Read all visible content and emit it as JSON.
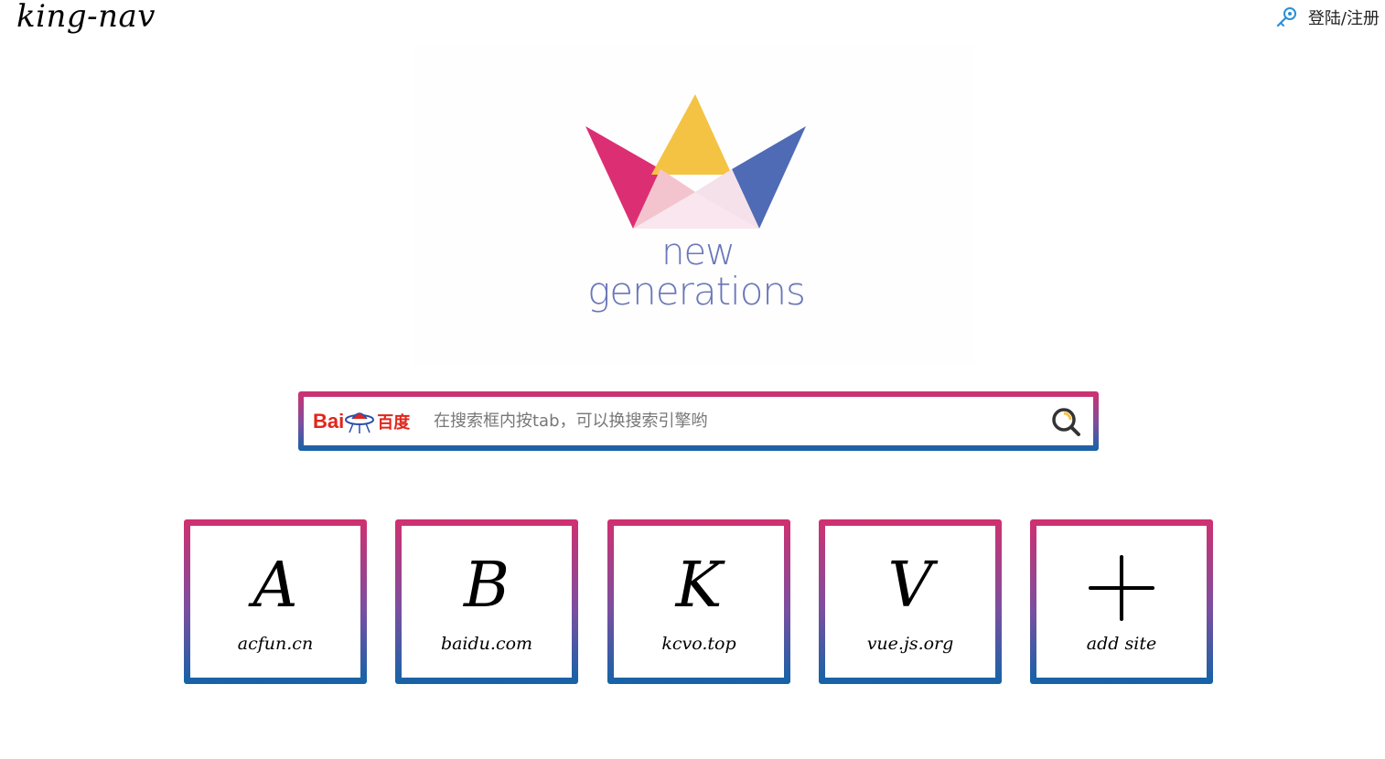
{
  "header": {
    "brand": "king-nav",
    "login_label": "登陆/注册",
    "login_icon": "key-icon"
  },
  "hero": {
    "line1": "new",
    "line2": "generations",
    "colors": {
      "left_petal": "#dc2f73",
      "center_petal": "#f4c344",
      "right_petal": "#4f6bb5",
      "text": "#6a77b8"
    }
  },
  "search": {
    "engine_text": "Bai",
    "engine_text_cn": "百度",
    "engine_icon": "baidu-logo-icon",
    "placeholder": "在搜索框内按tab，可以换搜索引擎哟",
    "value": "",
    "button_icon": "search-icon"
  },
  "sites": [
    {
      "letter": "A",
      "label": "acfun.cn"
    },
    {
      "letter": "B",
      "label": "baidu.com"
    },
    {
      "letter": "K",
      "label": "kcvo.top"
    },
    {
      "letter": "V",
      "label": "vue.js.org"
    }
  ],
  "add_site": {
    "label": "add site",
    "icon": "plus-icon"
  },
  "colors": {
    "gradient_top": "#d0306f",
    "gradient_bottom": "#1463a7",
    "engine_red": "#e1251b"
  }
}
